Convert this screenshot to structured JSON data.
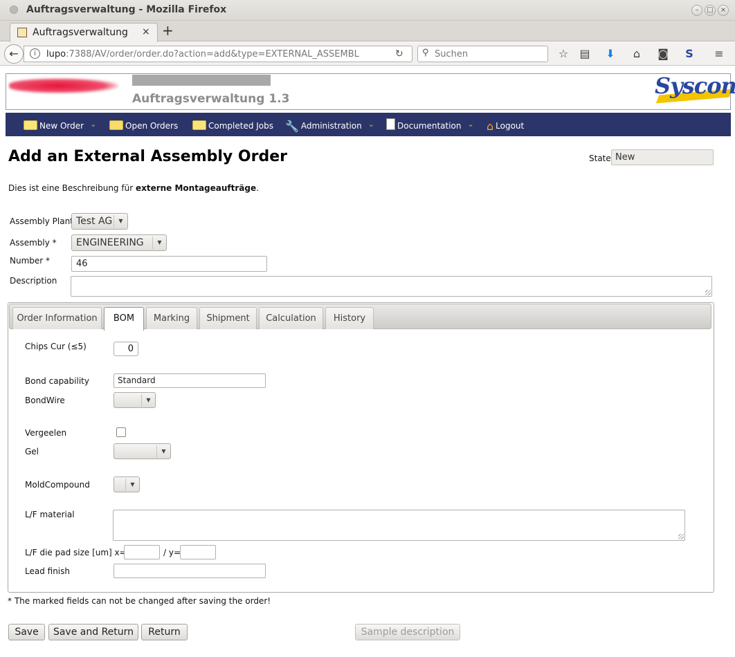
{
  "browser": {
    "window_title": "Auftragsverwaltung - Mozilla Firefox",
    "tab_title": "Auftragsverwaltung",
    "url_host": "lupo",
    "url_rest": ":7388/AV/order/order.do?action=add&type=EXTERNAL_ASSEMBL",
    "search_placeholder": "Suchen"
  },
  "header": {
    "app_title": "Auftragsverwaltung 1.3",
    "brand": "Syscon"
  },
  "menu": {
    "items": [
      {
        "label": "New Order"
      },
      {
        "label": "Open Orders"
      },
      {
        "label": "Completed Jobs"
      },
      {
        "label": "Administration"
      },
      {
        "label": "Documentation"
      },
      {
        "label": "Logout"
      }
    ]
  },
  "page": {
    "title": "Add an External Assembly Order",
    "state_label": "State",
    "state_value": "New",
    "desc_prefix": "Dies ist eine Beschreibung für ",
    "desc_bold": "externe Montageaufträge",
    "desc_suffix": "."
  },
  "form": {
    "assembly_plant_label": "Assembly Plant",
    "assembly_plant_value": "Test AG",
    "assembly_label": "Assembly *",
    "assembly_value": "ENGINEERING",
    "number_label": "Number *",
    "number_value": "46",
    "description_label": "Description"
  },
  "tabs": [
    {
      "label": "Order Information"
    },
    {
      "label": "BOM"
    },
    {
      "label": "Marking"
    },
    {
      "label": "Shipment"
    },
    {
      "label": "Calculation"
    },
    {
      "label": "History"
    }
  ],
  "bom": {
    "chips_cur_label": "Chips Cur (≤5)",
    "chips_cur_value": "0",
    "bond_capability_label": "Bond capability",
    "bond_capability_value": "Standard",
    "bondwire_label": "BondWire",
    "vergeelen_label": "Vergeelen",
    "gel_label": "Gel",
    "moldcompound_label": "MoldCompound",
    "lf_material_label": "L/F material",
    "lf_pad_label": "L/F die pad size [um] x=",
    "lf_pad_y_label": "/ y=",
    "lead_finish_label": "Lead finish"
  },
  "footnote": "* The marked fields can not be changed after saving the order!",
  "buttons": {
    "save": "Save",
    "save_return": "Save and Return",
    "return": "Return",
    "sample": "Sample description"
  }
}
